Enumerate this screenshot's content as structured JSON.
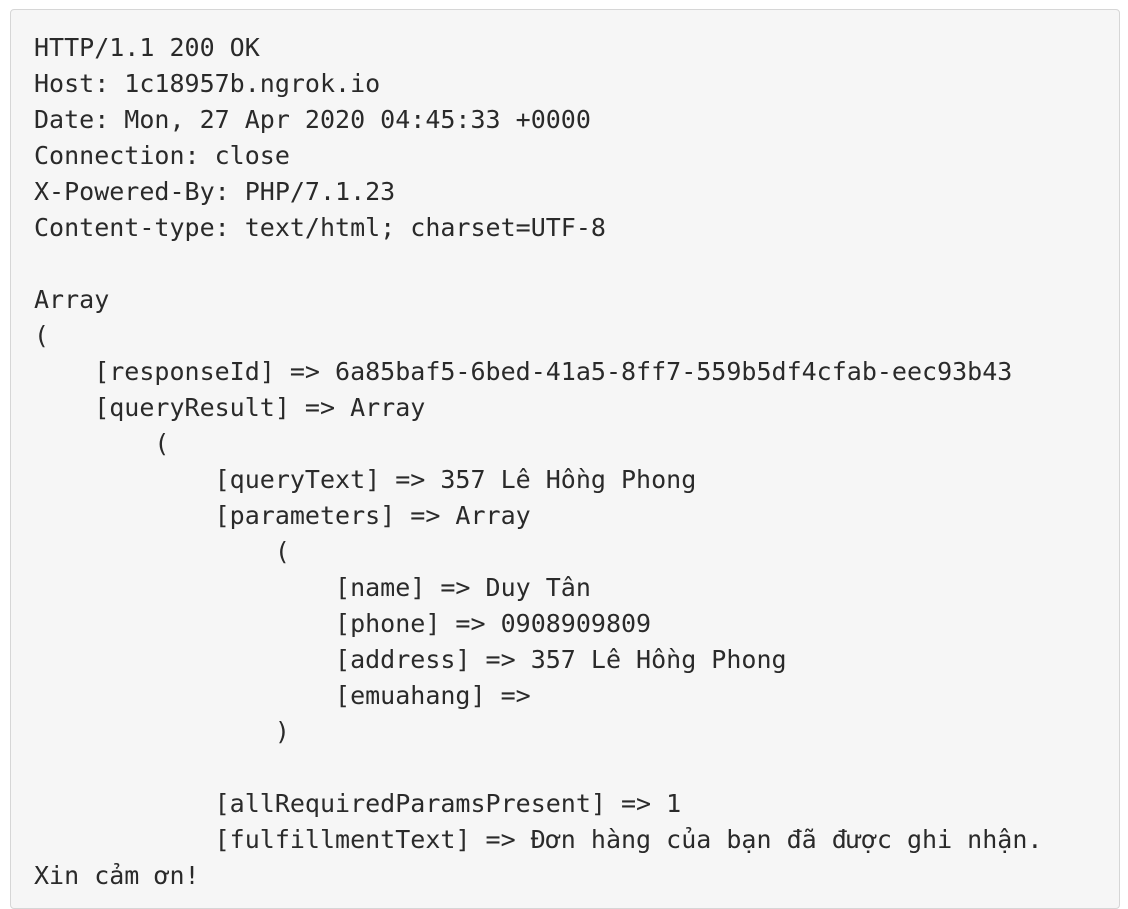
{
  "code_block": {
    "lines": [
      "HTTP/1.1 200 OK",
      "Host: 1c18957b.ngrok.io",
      "Date: Mon, 27 Apr 2020 04:45:33 +0000",
      "Connection: close",
      "X-Powered-By: PHP/7.1.23",
      "Content-type: text/html; charset=UTF-8",
      "",
      "Array",
      "(",
      "    [responseId] => 6a85baf5-6bed-41a5-8ff7-559b5df4cfab-eec93b43",
      "    [queryResult] => Array",
      "        (",
      "            [queryText] => 357 Lê Hồng Phong",
      "            [parameters] => Array",
      "                (",
      "                    [name] => Duy Tân",
      "                    [phone] => 0908909809",
      "                    [address] => 357 Lê Hồng Phong",
      "                    [emuahang] =>",
      "                )",
      "",
      "            [allRequiredParamsPresent] => 1",
      "            [fulfillmentText] => Đơn hàng của bạn đã được ghi nhận.",
      "Xin cảm ơn!"
    ]
  }
}
